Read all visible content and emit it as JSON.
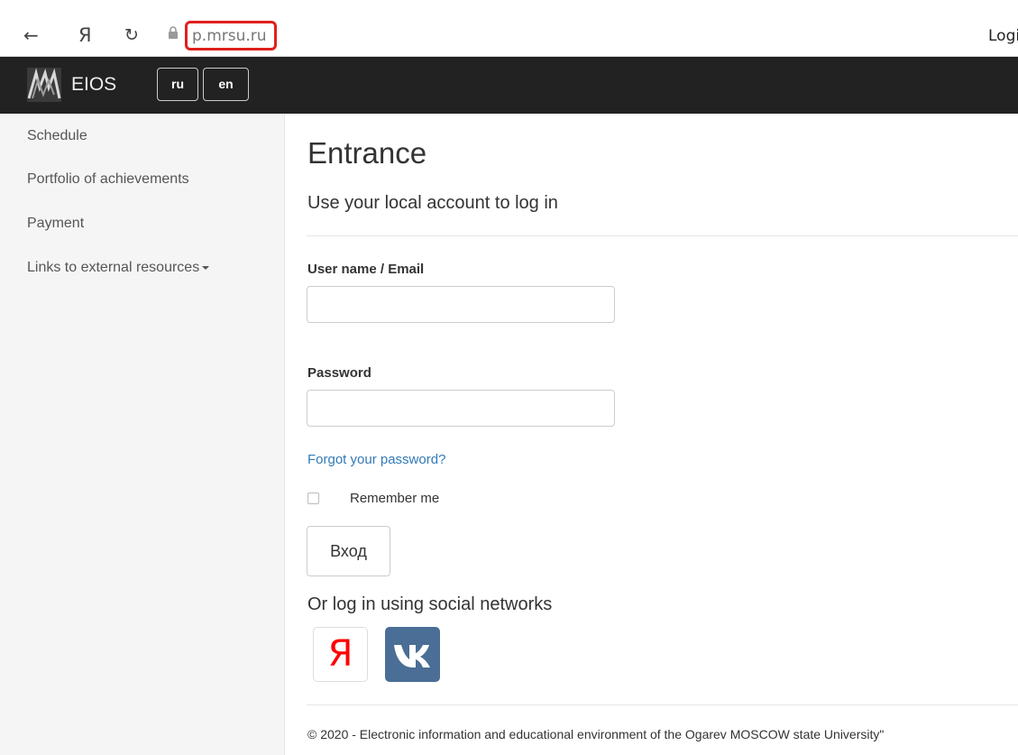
{
  "browser": {
    "back_icon": "←",
    "yandex_icon": "Я",
    "reload_icon": "↻",
    "url": "p.mrsu.ru",
    "right_tab": "Logi",
    "highlight_color": "#e0201e"
  },
  "navbar": {
    "brand": "EIOS",
    "lang_ru": "ru",
    "lang_en": "en",
    "background": "#222222"
  },
  "sidebar": {
    "items": [
      {
        "label": "Schedule"
      },
      {
        "label": "Portfolio of achievements"
      },
      {
        "label": "Payment"
      },
      {
        "label": "Links to external resources"
      }
    ]
  },
  "main": {
    "title": "Entrance",
    "subtitle": "Use your local account to log in",
    "username_label": "User name / Email",
    "username_value": "",
    "password_label": "Password",
    "password_value": "",
    "forgot_link": "Forgot your password?",
    "remember_label": "Remember me",
    "submit_label": "Вход",
    "social_title": "Or log in using social networks",
    "yandex_label": "Я",
    "vk_label": "VK",
    "link_color": "#337ab7"
  },
  "footer": {
    "text": "© 2020 - Electronic information and educational environment of the Ogarev MOSCOW state University\""
  }
}
